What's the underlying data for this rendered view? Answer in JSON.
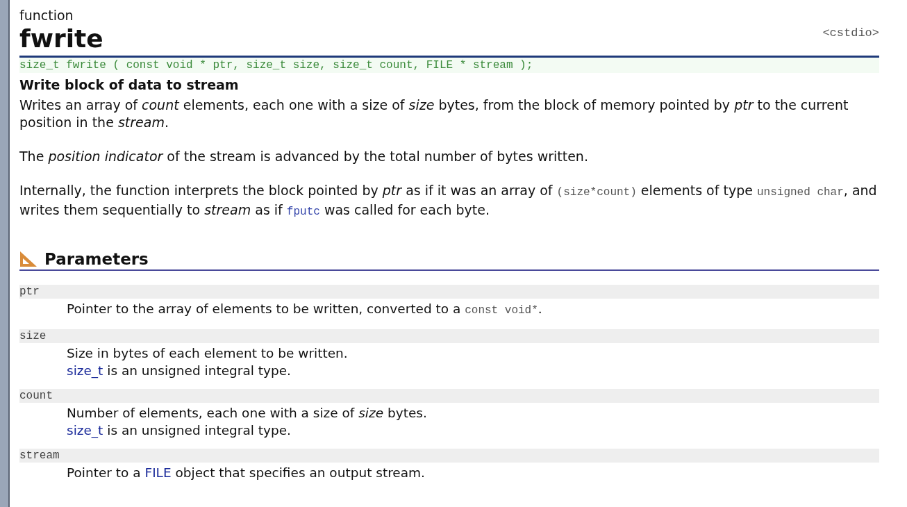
{
  "header": {
    "kind_label": "function",
    "name": "fwrite",
    "header_file": "<cstdio>"
  },
  "prototype": "size_t fwrite ( const void * ptr, size_t size, size_t count, FILE * stream );",
  "summary": "Write block of data to stream",
  "paragraphs": [
    [
      {
        "kind": "text",
        "text": "Writes an array of *count* elements, each one with a size of *size* bytes, from the block of memory pointed by *ptr* to the current position in the *stream*."
      }
    ],
    [
      {
        "kind": "text",
        "text": "The *position indicator* of the stream is advanced by the total number of bytes written."
      }
    ],
    [
      {
        "kind": "text",
        "text": "Internally, the function interprets the block pointed by *ptr* as if it was an array of "
      },
      {
        "kind": "code",
        "text": "(size*count)"
      },
      {
        "kind": "text",
        "text": " elements of type "
      },
      {
        "kind": "code",
        "text": "unsigned char"
      },
      {
        "kind": "text",
        "text": ", and writes them sequentially to *stream* as if "
      },
      {
        "kind": "code_link",
        "text": "fputc"
      },
      {
        "kind": "text",
        "text": " was called for each byte."
      }
    ]
  ],
  "parameters_section": {
    "title": "Parameters",
    "params": [
      {
        "name": "ptr",
        "lines": [
          [
            {
              "kind": "text",
              "text": "Pointer to the array of elements to be written, converted to a "
            },
            {
              "kind": "code",
              "text": "const void*"
            },
            {
              "kind": "text",
              "text": "."
            }
          ]
        ]
      },
      {
        "name": "size",
        "lines": [
          [
            {
              "kind": "text",
              "text": "Size in bytes of each element to be written."
            }
          ],
          [
            {
              "kind": "link",
              "text": "size_t"
            },
            {
              "kind": "text",
              "text": " is an unsigned integral type."
            }
          ]
        ]
      },
      {
        "name": "count",
        "lines": [
          [
            {
              "kind": "text",
              "text": "Number of elements, each one with a size of *size* bytes."
            }
          ],
          [
            {
              "kind": "link",
              "text": "size_t"
            },
            {
              "kind": "text",
              "text": " is an unsigned integral type."
            }
          ]
        ]
      },
      {
        "name": "stream",
        "lines": [
          [
            {
              "kind": "text",
              "text": "Pointer to a "
            },
            {
              "kind": "link",
              "text": "FILE"
            },
            {
              "kind": "text",
              "text": " object that specifies an output stream."
            }
          ]
        ]
      }
    ]
  }
}
